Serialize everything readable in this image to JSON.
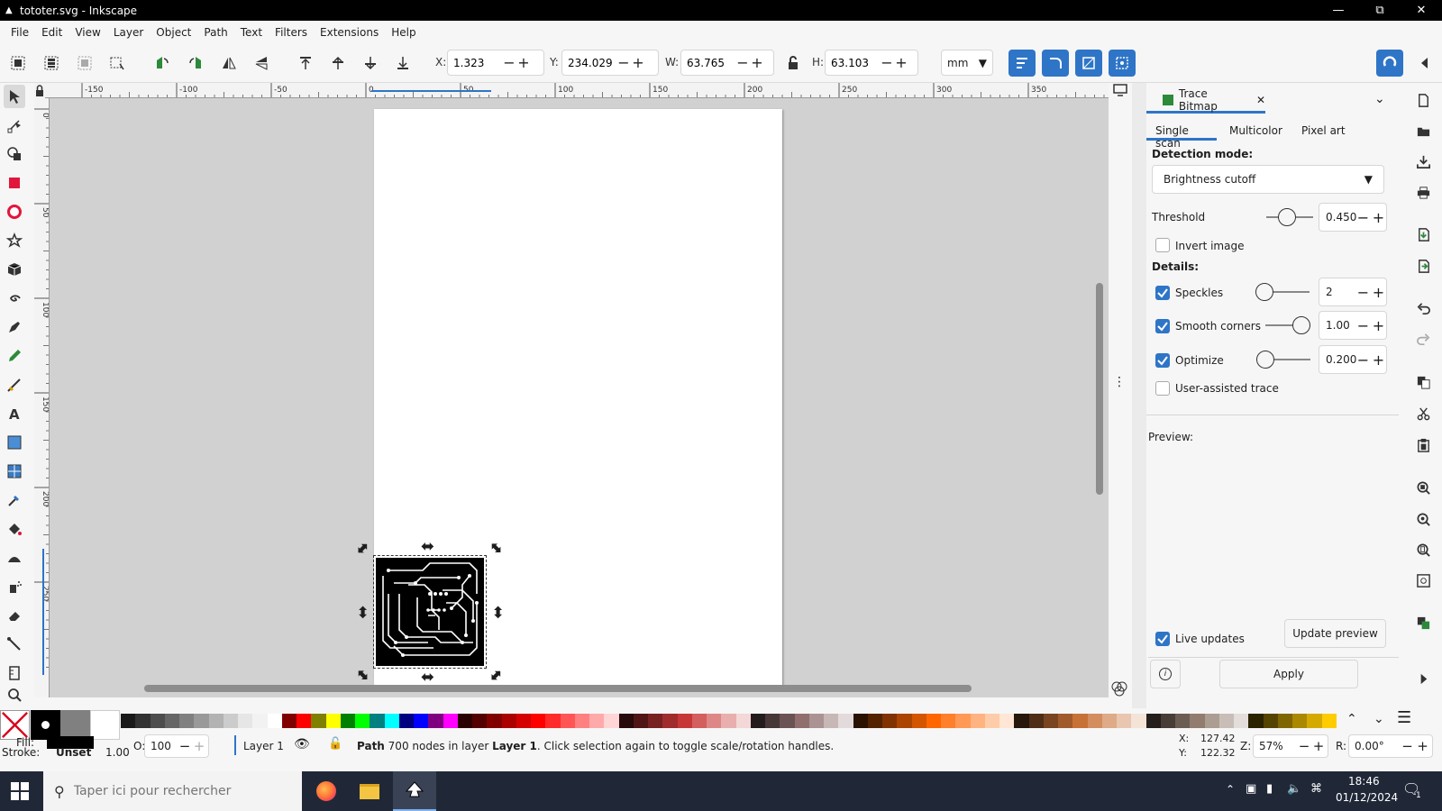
{
  "window": {
    "title": "tototer.svg - Inkscape"
  },
  "menu": [
    "File",
    "Edit",
    "View",
    "Layer",
    "Object",
    "Path",
    "Text",
    "Filters",
    "Extensions",
    "Help"
  ],
  "toolbar": {
    "x_label": "X:",
    "x_value": "1.323",
    "y_label": "Y:",
    "y_value": "234.029",
    "w_label": "W:",
    "w_value": "63.765",
    "h_label": "H:",
    "h_value": "63.103",
    "unit": "mm"
  },
  "rulers": {
    "h_ticks": [
      "-150",
      "-100",
      "-50",
      "0",
      "50",
      "100",
      "150",
      "200",
      "250",
      "300",
      "350"
    ],
    "v_ticks": [
      "0",
      "50",
      "100",
      "150",
      "200",
      "250"
    ]
  },
  "panel": {
    "title": "Trace Bitmap",
    "tabs": [
      "Single scan",
      "Multicolor",
      "Pixel art"
    ],
    "detection_mode_label": "Detection mode:",
    "detection_mode_value": "Brightness cutoff",
    "threshold_label": "Threshold",
    "threshold_value": "0.450",
    "threshold_level": 0.45,
    "invert_label": "Invert image",
    "details_label": "Details:",
    "speckles_label": "Speckles",
    "speckles_value": "2",
    "smooth_label": "Smooth corners",
    "smooth_value": "1.00",
    "optimize_label": "Optimize",
    "optimize_value": "0.200",
    "user_assisted_label": "User-assisted trace",
    "preview_label": "Preview:",
    "live_updates_label": "Live updates",
    "update_preview_label": "Update preview",
    "apply_label": "Apply"
  },
  "status": {
    "fill_label": "Fill:",
    "stroke_label": "Stroke:",
    "stroke_value": "Unset",
    "stroke_width": "1.00",
    "opacity_label": "O:",
    "opacity_value": "100",
    "layer": "Layer 1",
    "message_bold": "Path",
    "message_rest": " 700 nodes in layer ",
    "message_layer": "Layer 1",
    "message_end": ". Click selection again to toggle scale/rotation handles.",
    "cursor_x_label": "X:",
    "cursor_x": "127.42",
    "cursor_y_label": "Y:",
    "cursor_y": "122.32",
    "zoom_label": "Z:",
    "zoom": "57%",
    "rotate_label": "R:",
    "rotate": "0.00°"
  },
  "taskbar": {
    "search_placeholder": "Taper ici pour rechercher",
    "time": "18:46",
    "date": "01/12/2024",
    "notif_count": "1"
  },
  "colors": {
    "accent": "#2e75c7",
    "canvas_bg": "#d1d1d1",
    "taskbar": "#202838"
  }
}
